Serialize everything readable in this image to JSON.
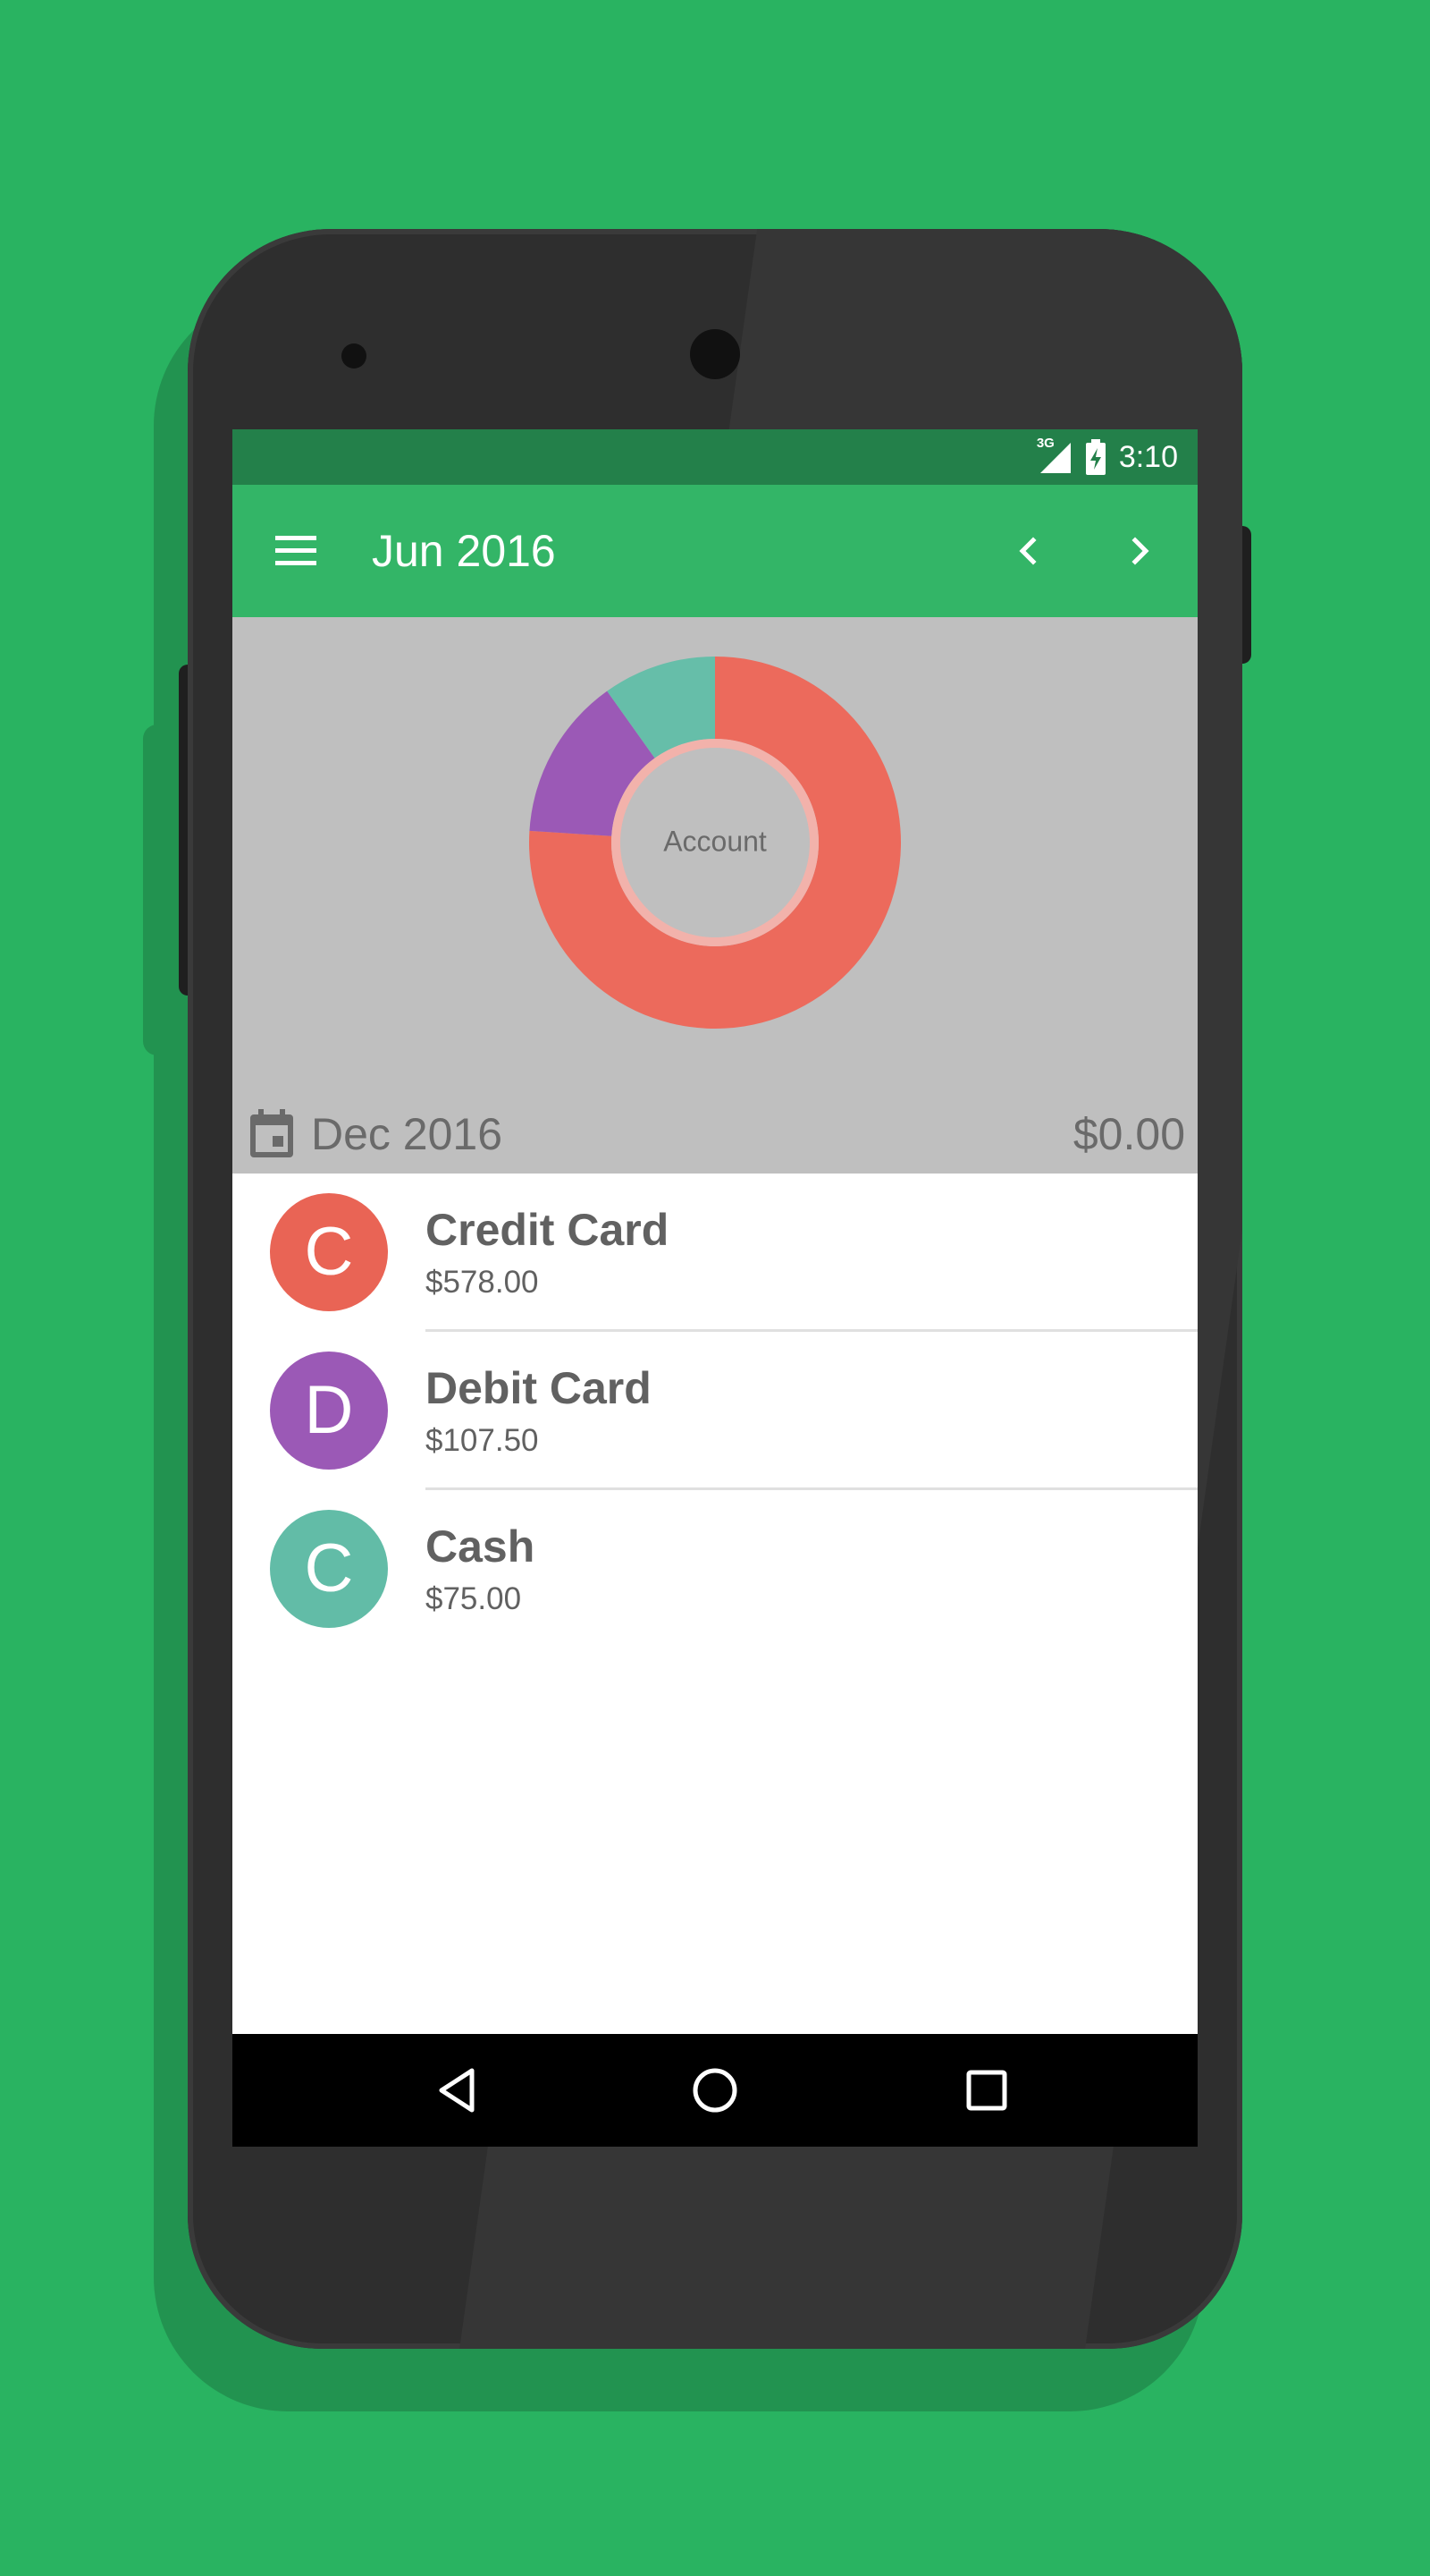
{
  "status_bar": {
    "network": "3G",
    "time": "3:10"
  },
  "app_bar": {
    "title": "Jun 2016",
    "menu_icon": "menu-icon",
    "prev_icon": "chevron-left-icon",
    "next_icon": "chevron-right-icon"
  },
  "chart": {
    "center_label": "Account",
    "period": "Dec 2016",
    "total": "$0.00",
    "calendar_icon": "calendar-icon"
  },
  "chart_data": {
    "type": "pie",
    "categories": [
      "Credit Card",
      "Debit Card",
      "Cash"
    ],
    "values": [
      578.0,
      107.5,
      75.0
    ],
    "colors": [
      "#ec6a5c",
      "#9b59b6",
      "#66bea9"
    ]
  },
  "accounts": [
    {
      "initial": "C",
      "name": "Credit Card",
      "amount": "$578.00",
      "color": "#e96455"
    },
    {
      "initial": "D",
      "name": "Debit Card",
      "amount": "$107.50",
      "color": "#9b59b6"
    },
    {
      "initial": "C",
      "name": "Cash",
      "amount": "$75.00",
      "color": "#62bca7"
    }
  ],
  "nav_bar": {
    "back_icon": "back-triangle-icon",
    "home_icon": "home-circle-icon",
    "recents_icon": "recents-square-icon"
  }
}
